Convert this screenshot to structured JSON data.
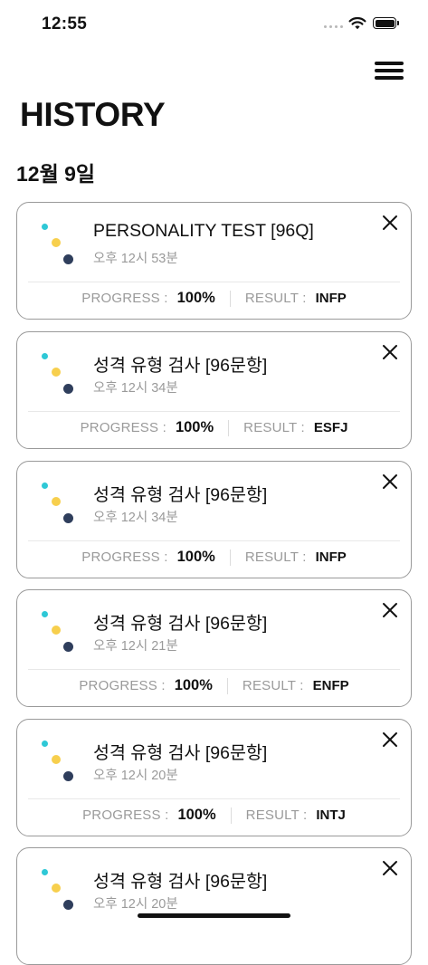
{
  "status_bar": {
    "time": "12:55"
  },
  "header": {
    "title": "HISTORY"
  },
  "date_group": {
    "label": "12월 9일"
  },
  "labels": {
    "progress": "PROGRESS :",
    "result": "RESULT :"
  },
  "records": [
    {
      "title": "PERSONALITY TEST [96Q]",
      "time": "오후 12시 53분",
      "progress": "100%",
      "result": "INFP"
    },
    {
      "title": "성격 유형 검사 [96문항]",
      "time": "오후 12시 34분",
      "progress": "100%",
      "result": "ESFJ"
    },
    {
      "title": "성격 유형 검사 [96문항]",
      "time": "오후 12시 34분",
      "progress": "100%",
      "result": "INFP"
    },
    {
      "title": "성격 유형 검사 [96문항]",
      "time": "오후 12시 21분",
      "progress": "100%",
      "result": "ENFP"
    },
    {
      "title": "성격 유형 검사 [96문항]",
      "time": "오후 12시 20분",
      "progress": "100%",
      "result": "INTJ"
    },
    {
      "title": "성격 유형 검사 [96문항]",
      "time": "오후 12시 20분",
      "progress": "",
      "result": ""
    }
  ],
  "colors": {
    "dot_top": "#2ec8d6",
    "dot_middle": "#f7cf4d",
    "dot_bottom": "#2f3e5c",
    "card_border": "#9a9a9a",
    "muted_text": "#9a9a9a"
  },
  "icons": {
    "menu": "hamburger-menu-icon",
    "delete": "close-icon",
    "record": "three-dots-test-icon",
    "wifi": "wifi-icon",
    "battery": "battery-icon",
    "signal": "signal-icon"
  }
}
